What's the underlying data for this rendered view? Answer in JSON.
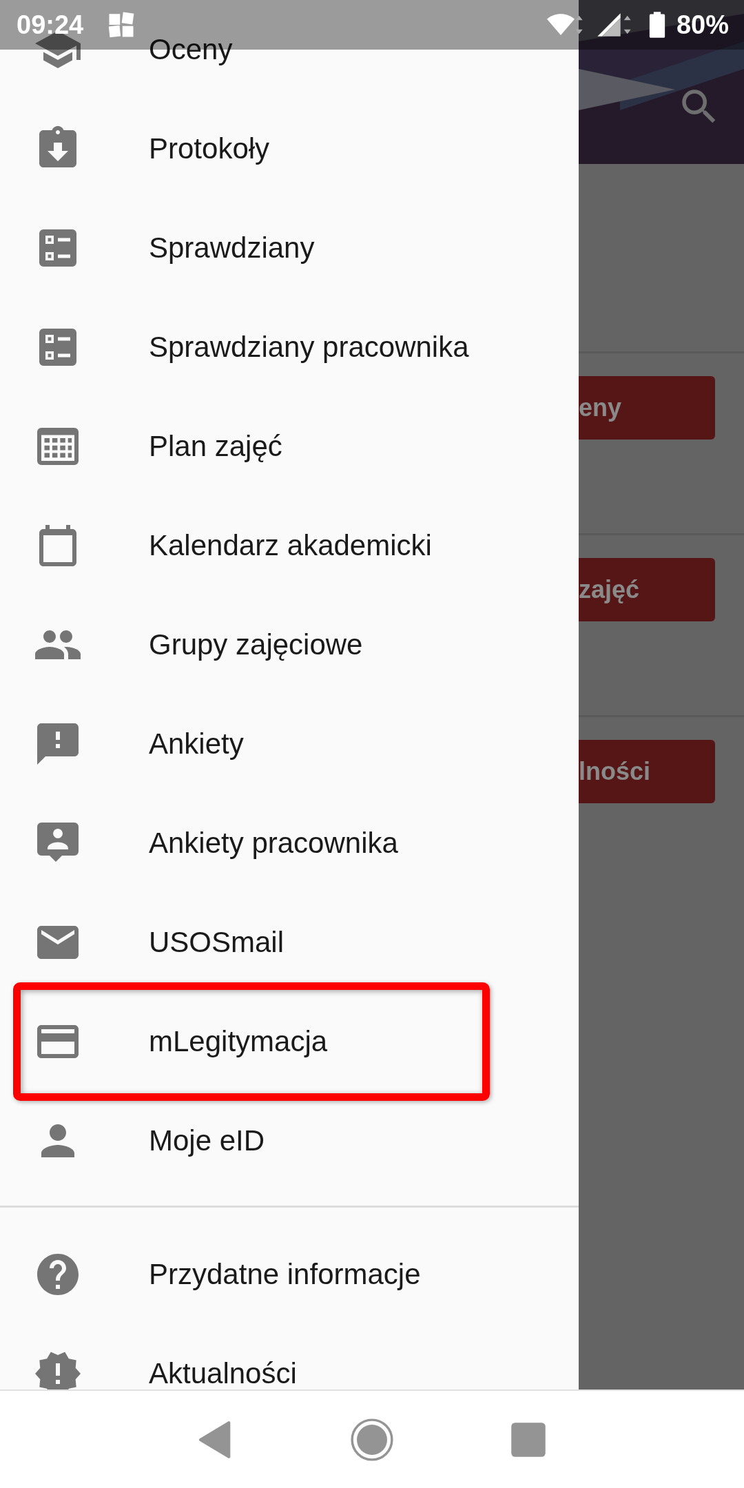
{
  "status_bar": {
    "time": "09:24",
    "battery": "80%"
  },
  "background": {
    "buttons": [
      {
        "label": "eny"
      },
      {
        "label": "zajęć"
      },
      {
        "label": "lności"
      }
    ]
  },
  "drawer": {
    "items": [
      {
        "label": "Oceny",
        "kind": "school",
        "highlighted": false
      },
      {
        "label": "Protokoły",
        "kind": "clipboard",
        "highlighted": false
      },
      {
        "label": "Sprawdziany",
        "kind": "checklist",
        "highlighted": false
      },
      {
        "label": "Sprawdziany pracownika",
        "kind": "checklist",
        "highlighted": false
      },
      {
        "label": "Plan zajęć",
        "kind": "grid",
        "highlighted": false
      },
      {
        "label": "Kalendarz akademicki",
        "kind": "calendar",
        "highlighted": false
      },
      {
        "label": "Grupy zajęciowe",
        "kind": "people",
        "highlighted": false
      },
      {
        "label": "Ankiety",
        "kind": "feedback",
        "highlighted": false
      },
      {
        "label": "Ankiety pracownika",
        "kind": "person-bubble",
        "highlighted": false
      },
      {
        "label": "USOSmail",
        "kind": "mail",
        "highlighted": false
      },
      {
        "label": "mLegitymacja",
        "kind": "card",
        "highlighted": true
      },
      {
        "label": "Moje eID",
        "kind": "person",
        "highlighted": false
      }
    ],
    "footer_items": [
      {
        "label": "Przydatne informacje",
        "kind": "help",
        "highlighted": false
      },
      {
        "label": "Aktualności",
        "kind": "badge",
        "highlighted": false
      }
    ]
  }
}
